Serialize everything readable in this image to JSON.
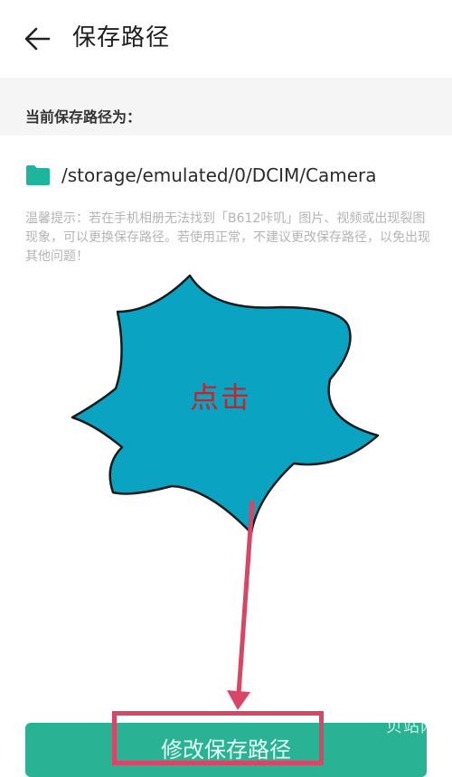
{
  "header": {
    "back_icon": "arrow-left-icon",
    "title": "保存路径"
  },
  "section": {
    "label": "当前保存路径为："
  },
  "path": {
    "folder_icon": "folder-icon",
    "value": "/storage/emulated/0/DCIM/Camera"
  },
  "tip": {
    "text": "温馨提示：若在手机相册无法找到「B612咔叽」图片、视频或出现裂图现象，可以更换保存路径。若使用正常，不建议更改保存路径，以免出现其他问题！"
  },
  "annotation": {
    "click_label": "点击",
    "starburst_color": "#0aa3c2",
    "arrow_color": "#d94564"
  },
  "action": {
    "button_label": "修改保存路径",
    "button_color": "#29b394"
  },
  "watermark": {
    "text": "贝站网"
  }
}
